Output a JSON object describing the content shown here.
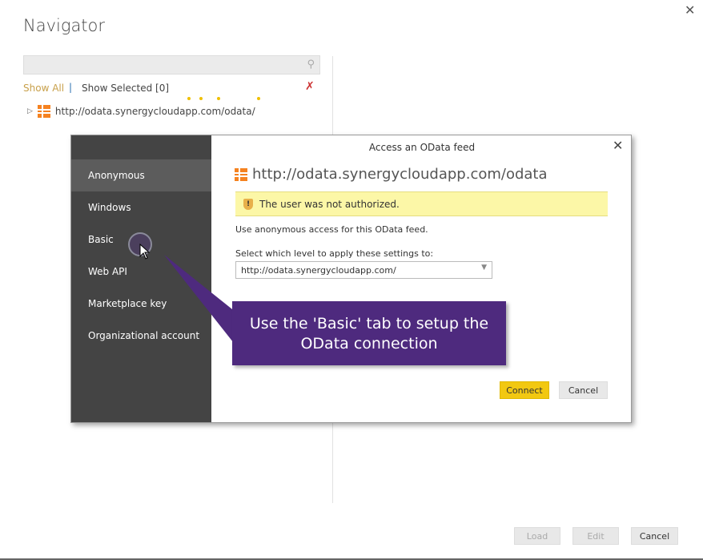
{
  "navigator": {
    "title": "Navigator",
    "search_placeholder": "",
    "show_all": "Show All",
    "separator": "|",
    "show_selected": "Show Selected [0]",
    "tree_item": "http://odata.synergycloudapp.com/odata/",
    "buttons": {
      "load": "Load",
      "edit": "Edit",
      "cancel": "Cancel"
    }
  },
  "dialog": {
    "title": "Access an OData feed",
    "url": "http://odata.synergycloudapp.com/odata",
    "warning": "The user was not authorized.",
    "description": "Use anonymous access for this OData feed.",
    "level_label": "Select which level to apply these settings to:",
    "level_value": "http://odata.synergycloudapp.com/",
    "connect": "Connect",
    "cancel": "Cancel",
    "auth_tabs": [
      {
        "label": "Anonymous",
        "selected": true
      },
      {
        "label": "Windows"
      },
      {
        "label": "Basic"
      },
      {
        "label": "Web API"
      },
      {
        "label": "Marketplace key"
      },
      {
        "label": "Organizational account"
      }
    ]
  },
  "callout": {
    "text": "Use the 'Basic' tab to setup the OData connection",
    "color": "#4e2a7e"
  },
  "colors": {
    "accent": "#f2c811",
    "sidebar": "#444444",
    "warning_bg": "#fcf7a7"
  }
}
